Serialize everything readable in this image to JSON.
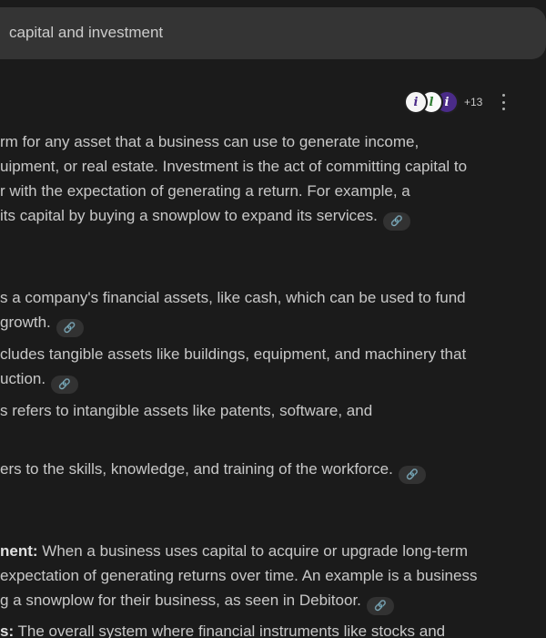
{
  "search": {
    "query": "capital and investment"
  },
  "sources": {
    "avatars": [
      "i",
      "l",
      "i"
    ],
    "more_count": "+13",
    "menu_icon": "more-vert-icon"
  },
  "answer": {
    "link_icon": "🔗",
    "intro": [
      "rm for any asset that a business can use to generate income,",
      "uipment, or real estate. Investment is the act of committing capital to",
      "r with the expectation of generating a return. For example, a",
      "its capital by buying a snowplow to expand its services."
    ],
    "capital_types": [
      [
        "s a company's financial assets, like cash, which can be used to fund",
        "growth."
      ],
      [
        "cludes tangible assets like buildings, equipment, and machinery that",
        "uction."
      ],
      [
        "s refers to intangible assets like patents, software, and"
      ],
      [
        "ers to the skills, knowledge, and training of the workforce."
      ]
    ],
    "investment_types": {
      "item1_label": "nent:",
      "item1_line1_rest": " When a business uses capital to acquire or upgrade long-term",
      "item1_line2": "expectation of generating returns over time. An example is a business",
      "item1_line3": "g a snowplow for their business, as seen in Debitoor.",
      "item2_label": "s:",
      "item2_line1_rest": " The overall system where financial instruments like stocks and"
    }
  }
}
